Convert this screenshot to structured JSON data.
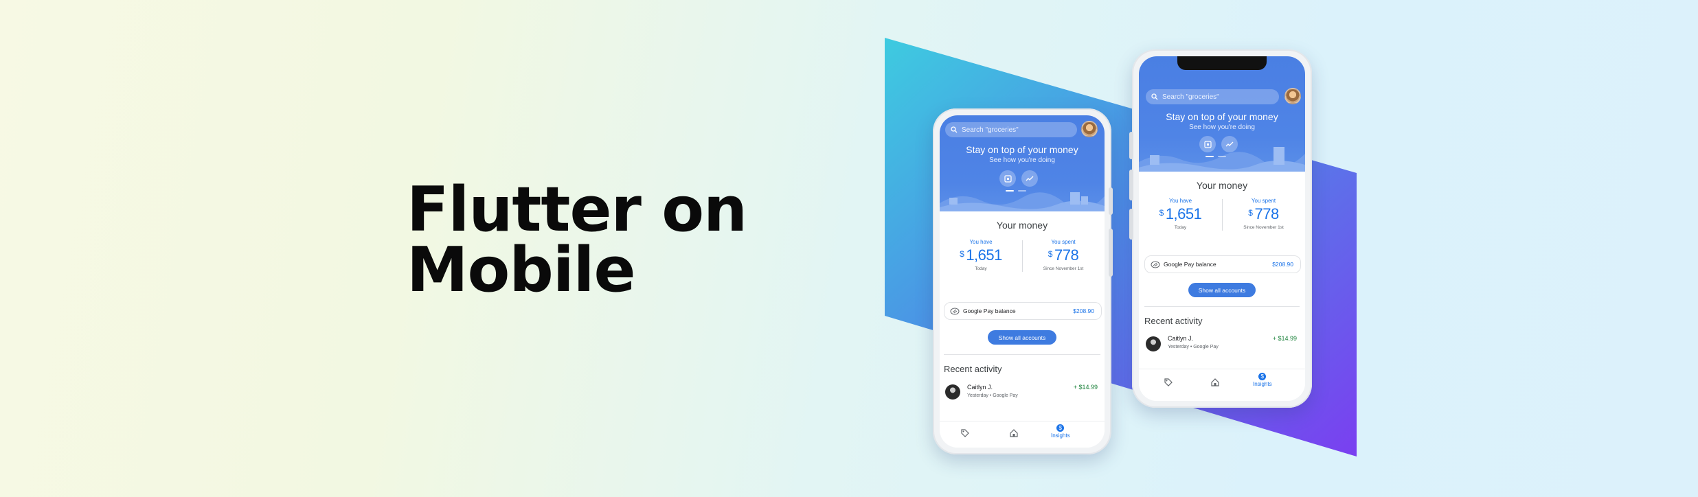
{
  "headline": {
    "line1": "Flutter on",
    "line2": "Mobile"
  },
  "colors": {
    "accent": "#1a73e8",
    "hero_blue": "#4f84e6",
    "positive": "#188038",
    "panel_gradient": [
      "#3ecbe0",
      "#4d8be6",
      "#7a3ff0"
    ]
  },
  "app": {
    "search_placeholder": "Search \"groceries\"",
    "hero_title": "Stay on top of your money",
    "hero_subtitle": "See how you're doing",
    "money_title": "Your money",
    "have": {
      "label": "You have",
      "currency": "$",
      "amount": "1,651",
      "sub": "Today"
    },
    "spent": {
      "label": "You spent",
      "currency": "$",
      "amount": "778",
      "sub": "Since November 1st"
    },
    "balance": {
      "label": "Google Pay balance",
      "value": "$208.90"
    },
    "show_all_label": "Show all accounts",
    "recent_title": "Recent activity",
    "activity": {
      "name": "Caitlyn J.",
      "meta": "Yesterday • Google Pay",
      "amount": "+ $14.99"
    },
    "nav": {
      "insights_label": "Insights",
      "badge": "$"
    }
  }
}
